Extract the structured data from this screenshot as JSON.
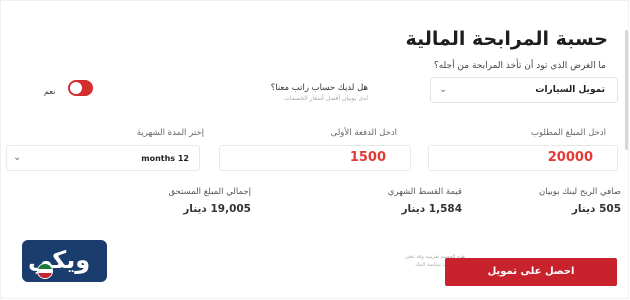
{
  "title": "حسبة المرابحة المالية",
  "purpose": {
    "question": "ما الغرض الذي تود أن تأخذ المرابحة من أجله؟",
    "selected": "تمويل السيارات"
  },
  "salary": {
    "question": "هل لديك حساب راتب معنا؟",
    "subtext": "لدى بوبيان أفضل أسعار الخصمات",
    "toggle_label": "نعم",
    "toggle_on": true,
    "toggle_color": "#d32f2f"
  },
  "inputs": {
    "amount": {
      "label": "ادخل المبلغ المطلوب",
      "value": "20000"
    },
    "down_payment": {
      "label": "ادخل الدفعة الأولى",
      "value": "1500"
    },
    "period": {
      "label": "إختر المدة الشهرية",
      "value": "12 months"
    }
  },
  "results": {
    "profit": {
      "label": "صافي الربح لبنك بوبيان",
      "value": "505 دينار"
    },
    "installment": {
      "label": "قيمة القسط الشهري",
      "value": "1,584 دينار"
    },
    "total": {
      "label": "إجمالي المبلغ المستحق",
      "value": "19,005 دينار"
    }
  },
  "disclaimer": {
    "line1": "هذه الحسبة تقريبية وقد تتغير",
    "line2": "حسب سياسة البنك"
  },
  "cta_label": "احصل على تمويل",
  "logo_text": "ويكي",
  "colors": {
    "accent": "#c8232c",
    "number": "#e53935",
    "logo_bg": "#1b3d6e"
  }
}
